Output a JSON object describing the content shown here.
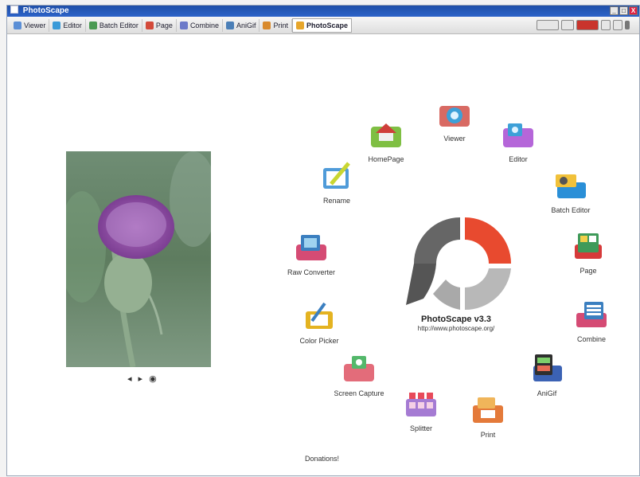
{
  "window": {
    "title": "PhotoScape"
  },
  "tabs": [
    {
      "label": "Viewer",
      "color": "#5b8fd6"
    },
    {
      "label": "Editor",
      "color": "#3b9ad8"
    },
    {
      "label": "Batch Editor",
      "color": "#4a9a53"
    },
    {
      "label": "Page",
      "color": "#d34a3a"
    },
    {
      "label": "Combine",
      "color": "#6c7ac9"
    },
    {
      "label": "AniGif",
      "color": "#4b7fb7"
    },
    {
      "label": "Print",
      "color": "#d98a2c"
    },
    {
      "label": "PhotoScape",
      "color": "#e7a62b"
    }
  ],
  "window_controls": {
    "minimize": "_",
    "maximize": "□",
    "close": "X"
  },
  "home": {
    "app_name": "PhotoScape v3.3",
    "url": "http://www.photoscape.org/",
    "donation": "Donations!",
    "photo_controls": {
      "prev": "◂",
      "next": "▸",
      "view": "◉"
    },
    "items": [
      {
        "label": "HomePage",
        "color": "#cf3f3b"
      },
      {
        "label": "Viewer",
        "color": "#3da0d8"
      },
      {
        "label": "Editor",
        "color": "#7a55b8"
      },
      {
        "label": "Rename",
        "color": "#4f9bd9"
      },
      {
        "label": "Batch Editor",
        "color": "#2a8fd7"
      },
      {
        "label": "Raw Converter",
        "color": "#d54b74"
      },
      {
        "label": "Page",
        "color": "#d63a3a"
      },
      {
        "label": "Color Picker",
        "color": "#e4b321"
      },
      {
        "label": "Combine",
        "color": "#3b7fc0"
      },
      {
        "label": "Screen Capture",
        "color": "#54b86b"
      },
      {
        "label": "AniGif",
        "color": "#3b62b4"
      },
      {
        "label": "Splitter",
        "color": "#a57bd3"
      },
      {
        "label": "Print",
        "color": "#e47a3a"
      }
    ]
  },
  "colors": {
    "accent": "#e84a2f",
    "logo_dark": "#555555",
    "logo_light": "#b8b8b8"
  }
}
